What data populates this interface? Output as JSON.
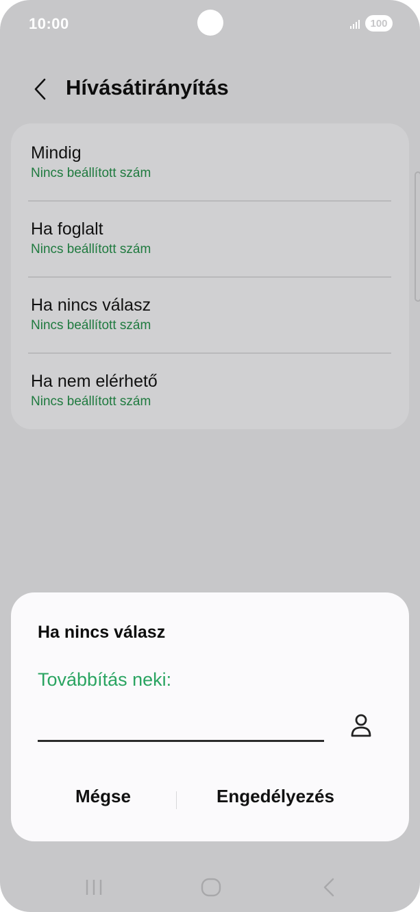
{
  "status_bar": {
    "time": "10:00",
    "battery": "100",
    "signal_icon": "signal-icon"
  },
  "header": {
    "back_icon": "chevron-left-icon",
    "title": "Hívásátirányítás"
  },
  "options": [
    {
      "title": "Mindig",
      "subtitle": "Nincs beállított szám"
    },
    {
      "title": "Ha foglalt",
      "subtitle": "Nincs beállított szám"
    },
    {
      "title": "Ha nincs válasz",
      "subtitle": "Nincs beállított szám"
    },
    {
      "title": "Ha nem elérhető",
      "subtitle": "Nincs beállított szám"
    }
  ],
  "dialog": {
    "title": "Ha nincs válasz",
    "label": "Továbbítás neki:",
    "input_value": "",
    "contact_icon": "person-icon",
    "cancel_label": "Mégse",
    "enable_label": "Engedélyezés"
  },
  "colors": {
    "accent_green": "#2aa461",
    "subtitle_green": "#1f7a3f",
    "background": "#c7c7c9",
    "dialog_background": "#fbfafc"
  },
  "nav_bar": {
    "recents_icon": "recents-icon",
    "home_icon": "home-icon",
    "back_icon": "back-icon"
  }
}
